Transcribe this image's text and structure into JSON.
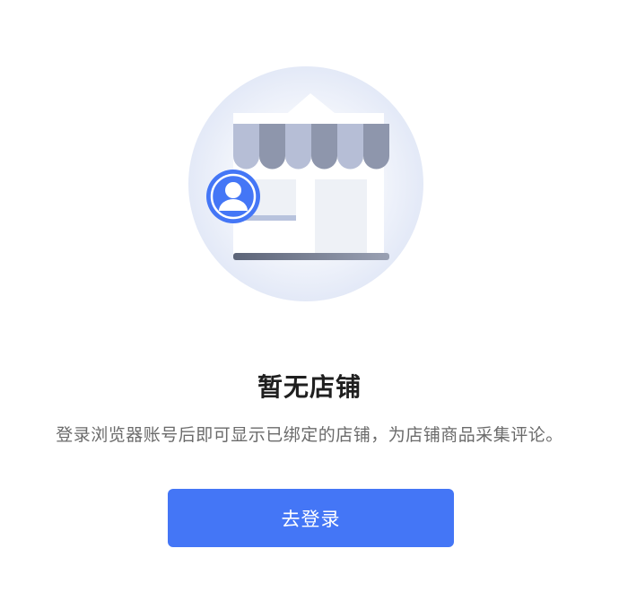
{
  "empty_state": {
    "title": "暂无店铺",
    "description": "登录浏览器账号后即可显示已绑定的店铺，为店铺商品采集评论。",
    "button_label": "去登录",
    "icon": "store-with-user-icon",
    "accent_color": "#4476f6"
  }
}
